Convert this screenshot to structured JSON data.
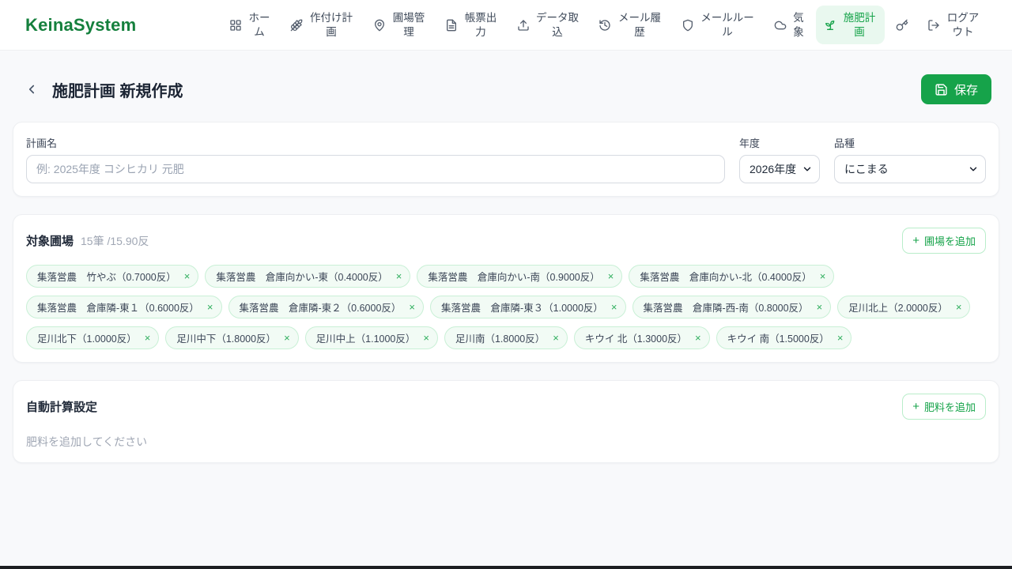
{
  "icons": {
    "plus": "+",
    "close": "×"
  },
  "header": {
    "logo": "KeinaSystem"
  },
  "nav": {
    "items": [
      {
        "label": "ホーム"
      },
      {
        "label": "作付け計画"
      },
      {
        "label": "圃場管理"
      },
      {
        "label": "帳票出力"
      },
      {
        "label": "データ取込"
      },
      {
        "label": "メール履歴"
      },
      {
        "label": "メールルール"
      },
      {
        "label": "気象"
      },
      {
        "label": "施肥計画"
      },
      {
        "label": "ログアウト"
      }
    ]
  },
  "page": {
    "title": "施肥計画 新規作成",
    "save_label": "保存"
  },
  "plan_form": {
    "name_label": "計画名",
    "name_placeholder": "例: 2025年度 コシヒカリ 元肥",
    "year_label": "年度",
    "year_value": "2026年度",
    "variety_label": "品種",
    "variety_value": "にこまる"
  },
  "fields_section": {
    "title": "対象圃場",
    "summary": "15筆 /15.90反",
    "add_button": "圃場を追加",
    "tags": [
      "集落営農　竹やぶ（0.7000反）",
      "集落営農　倉庫向かい-東（0.4000反）",
      "集落営農　倉庫向かい-南（0.9000反）",
      "集落営農　倉庫向かい-北（0.4000反）",
      "集落営農　倉庫隣-東１（0.6000反）",
      "集落営農　倉庫隣-東２（0.6000反）",
      "集落営農　倉庫隣-東３（1.0000反）",
      "集落営農　倉庫隣-西-南（0.8000反）",
      "足川北上（2.0000反）",
      "足川北下（1.0000反）",
      "足川中下（1.8000反）",
      "足川中上（1.1000反）",
      "足川南（1.8000反）",
      "キウイ 北（1.3000反）",
      "キウイ 南（1.5000反）"
    ]
  },
  "fertilizer_section": {
    "title": "自動計算設定",
    "add_button": "肥料を追加",
    "empty_text": "肥料を追加してください"
  }
}
